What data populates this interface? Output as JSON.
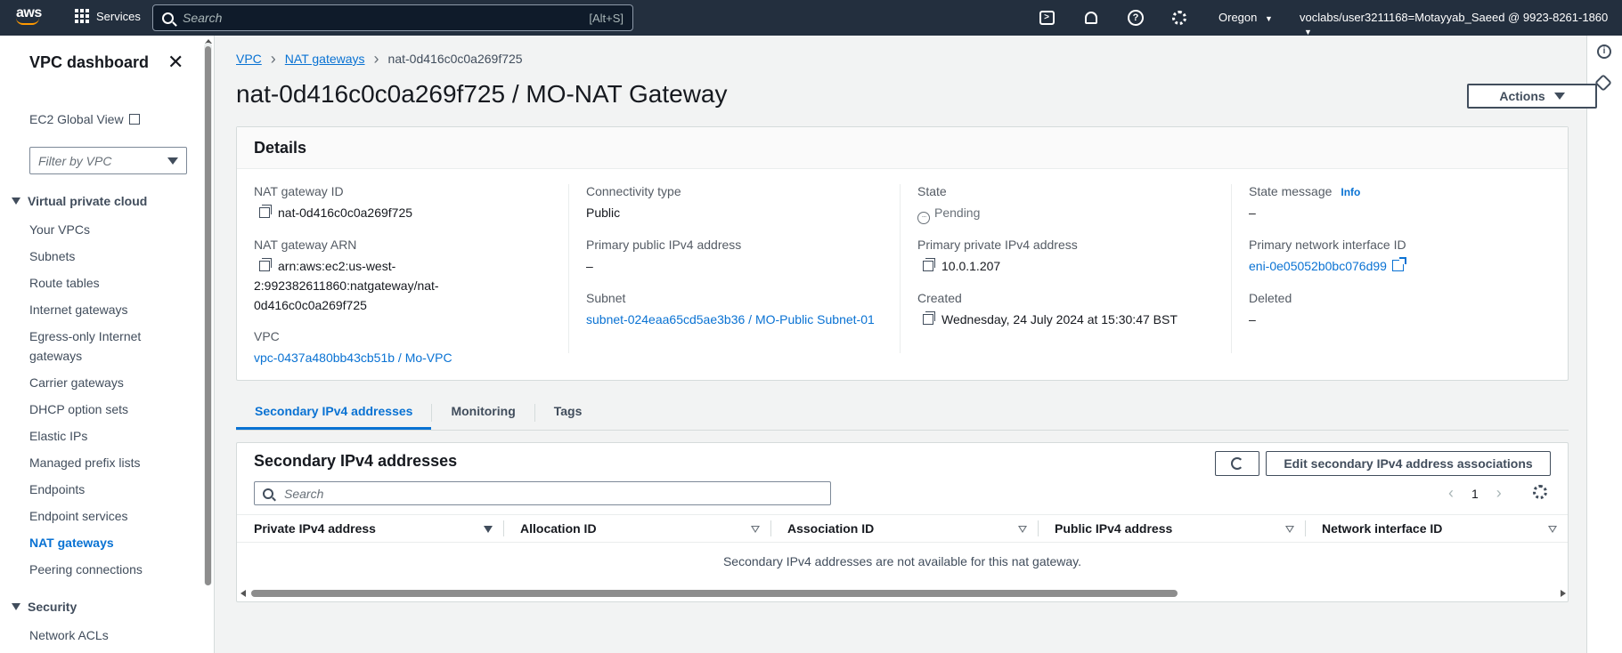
{
  "colors": {
    "nav_bg": "#232f3e",
    "link": "#0972d3",
    "brand_accent": "#ff9900"
  },
  "topnav": {
    "logo_text": "aws",
    "services_label": "Services",
    "search_placeholder": "Search",
    "search_shortcut": "[Alt+S]",
    "icons": [
      "cloudshell-icon",
      "notifications-icon",
      "help-icon",
      "settings-icon"
    ],
    "region": "Oregon",
    "account": "voclabs/user3211168=Motayyab_Saeed @ 9923-8261-1860"
  },
  "sidebar": {
    "title": "VPC dashboard",
    "global_view": "EC2 Global View",
    "filter_placeholder": "Filter by VPC",
    "section_vpc": "Virtual private cloud",
    "items": [
      "Your VPCs",
      "Subnets",
      "Route tables",
      "Internet gateways",
      "Egress-only Internet",
      "gateways",
      "Carrier gateways",
      "DHCP option sets",
      "Elastic IPs",
      "Managed prefix lists",
      "Endpoints",
      "Endpoint services",
      "NAT gateways",
      "Peering connections"
    ],
    "section_security": "Security",
    "security_items": [
      "Network ACLs"
    ]
  },
  "breadcrumb": {
    "root": "VPC",
    "parent": "NAT gateways",
    "current": "nat-0d416c0c0a269f725"
  },
  "page": {
    "title": "nat-0d416c0c0a269f725 / MO-NAT Gateway",
    "actions_label": "Actions"
  },
  "details": {
    "heading": "Details",
    "nat_id_label": "NAT gateway ID",
    "nat_id": "nat-0d416c0c0a269f725",
    "arn_label": "NAT gateway ARN",
    "arn_line1": "arn:aws:ec2:us-west-",
    "arn_line2": "2:992382611860:natgateway/nat-",
    "arn_line3": "0d416c0c0a269f725",
    "vpc_label": "VPC",
    "vpc": "vpc-0437a480bb43cb51b / Mo-VPC",
    "connectivity_label": "Connectivity type",
    "connectivity": "Public",
    "public_ip_label": "Primary public IPv4 address",
    "public_ip": "–",
    "subnet_label": "Subnet",
    "subnet": "subnet-024eaa65cd5ae3b36 / MO-Public Subnet-01",
    "state_label": "State",
    "state": "Pending",
    "private_ip_label": "Primary private IPv4 address",
    "private_ip": "10.0.1.207",
    "created_label": "Created",
    "created": "Wednesday, 24 July 2024 at 15:30:47 BST",
    "state_msg_label": "State message",
    "info_label": "Info",
    "state_msg": "–",
    "eni_label": "Primary network interface ID",
    "eni": "eni-0e05052b0bc076d99",
    "deleted_label": "Deleted",
    "deleted": "–"
  },
  "tabs": [
    "Secondary IPv4 addresses",
    "Monitoring",
    "Tags"
  ],
  "secondary": {
    "title": "Secondary IPv4 addresses",
    "edit_label": "Edit secondary IPv4 address associations",
    "search_placeholder": "Search",
    "page": "1",
    "columns": [
      "Private IPv4 address",
      "Allocation ID",
      "Association ID",
      "Public IPv4 address",
      "Network interface ID"
    ],
    "empty": "Secondary IPv4 addresses are not available for this nat gateway."
  }
}
